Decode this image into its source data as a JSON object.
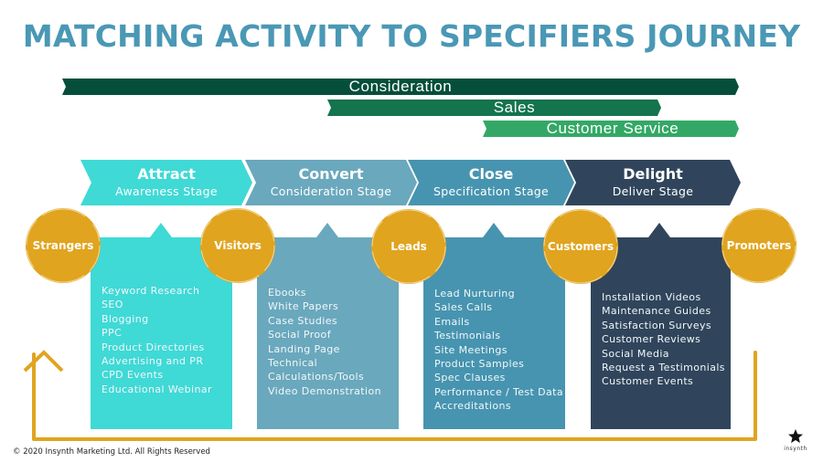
{
  "title": "MATCHING ACTIVITY TO SPECIFIERS JOURNEY",
  "bands": [
    {
      "label": "Consideration",
      "color": "#054f3a"
    },
    {
      "label": "Sales",
      "color": "#13744d"
    },
    {
      "label": "Customer Service",
      "color": "#33a866"
    }
  ],
  "stages": [
    {
      "title": "Attract",
      "subtitle": "Awareness Stage",
      "color": "#3fd9d6",
      "activities": [
        "Keyword Research",
        "SEO",
        "Blogging",
        "PPC",
        "Product Directories",
        "Advertising and PR",
        "CPD Events",
        "Educational Webinar"
      ]
    },
    {
      "title": "Convert",
      "subtitle": "Consideration Stage",
      "color": "#6aa8bd",
      "activities": [
        "Ebooks",
        "White Papers",
        "Case Studies",
        "Social Proof",
        "Landing Page",
        "Technical",
        "Calculations/Tools",
        "Video Demonstration"
      ]
    },
    {
      "title": "Close",
      "subtitle": "Specification Stage",
      "color": "#4794b0",
      "activities": [
        "Lead Nurturing",
        "Sales Calls",
        "Emails",
        "Testimonials",
        "Site Meetings",
        "Product Samples",
        "Spec Clauses",
        "Performance / Test Data",
        "Accreditations"
      ]
    },
    {
      "title": "Delight",
      "subtitle": "Deliver Stage",
      "color": "#30455b",
      "activities": [
        "Installation Videos",
        "Maintenance Guides",
        "Satisfaction Surveys",
        "Customer Reviews",
        "Social Media",
        "Request a Testimonials",
        "Customer Events"
      ]
    }
  ],
  "personas": [
    "Strangers",
    "Visitors",
    "Leads",
    "Customers",
    "Promoters"
  ],
  "accent_color": "#e0a41f",
  "footer": "© 2020 Insynth Marketing Ltd. All Rights Reserved",
  "logo": {
    "text": "insynth",
    "icon": "star-icon"
  }
}
